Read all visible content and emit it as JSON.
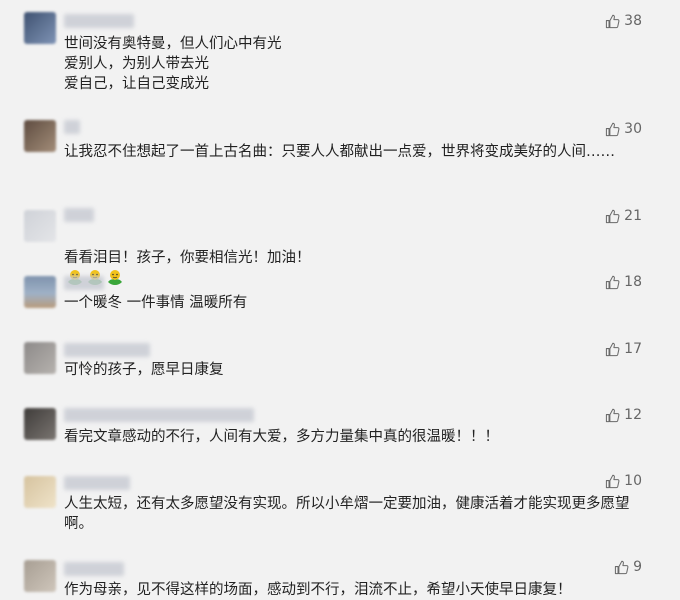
{
  "colors": {
    "background": "#f2f2f2",
    "text": "#222222",
    "like_count": "#666666",
    "like_icon": "#6a6a6a",
    "emoji_green": "#3aa63a",
    "emoji_yellow": "#f2c21a"
  },
  "comments": [
    {
      "text": "世间没有奥特曼，但人们心中有光\n爱别人，为别人带去光\n爱自己，让自己变成光",
      "likes": "38",
      "avatar_color": "#556a8c"
    },
    {
      "text": "让我忍不住想起了一首上古名曲：只要人人都献出一点爱，世界将变成美好的人间……",
      "likes": "30",
      "avatar_color": "#7a6656"
    },
    {
      "text": "看看泪目！孩子，你要相信光！加油！",
      "likes": "21",
      "avatar_color": "#d7d9dd",
      "emoji": [
        "cheer-emoji",
        "cheer-emoji",
        "cheer-emoji"
      ]
    },
    {
      "text": "一个暖冬 一件事情 温暖所有",
      "likes": "18",
      "avatar_color": "#8a97ab"
    },
    {
      "text": "可怜的孩子，愿早日康复",
      "likes": "17",
      "avatar_color": "#9c9a9a"
    },
    {
      "text": "看完文章感动的不行，人间有大爱，多方力量集中真的很温暖！！！",
      "likes": "12",
      "avatar_color": "#55524f"
    },
    {
      "text": "人生太短，还有太多愿望没有实现。所以小牟熠一定要加油，健康活着才能实现更多愿望啊。",
      "likes": "10",
      "avatar_color": "#e2cfae"
    },
    {
      "text": "作为母亲，见不得这样的场面，感动到不行，泪流不止，希望小天使早日康复！",
      "likes": "9",
      "avatar_color": "#b3aaa0"
    }
  ]
}
